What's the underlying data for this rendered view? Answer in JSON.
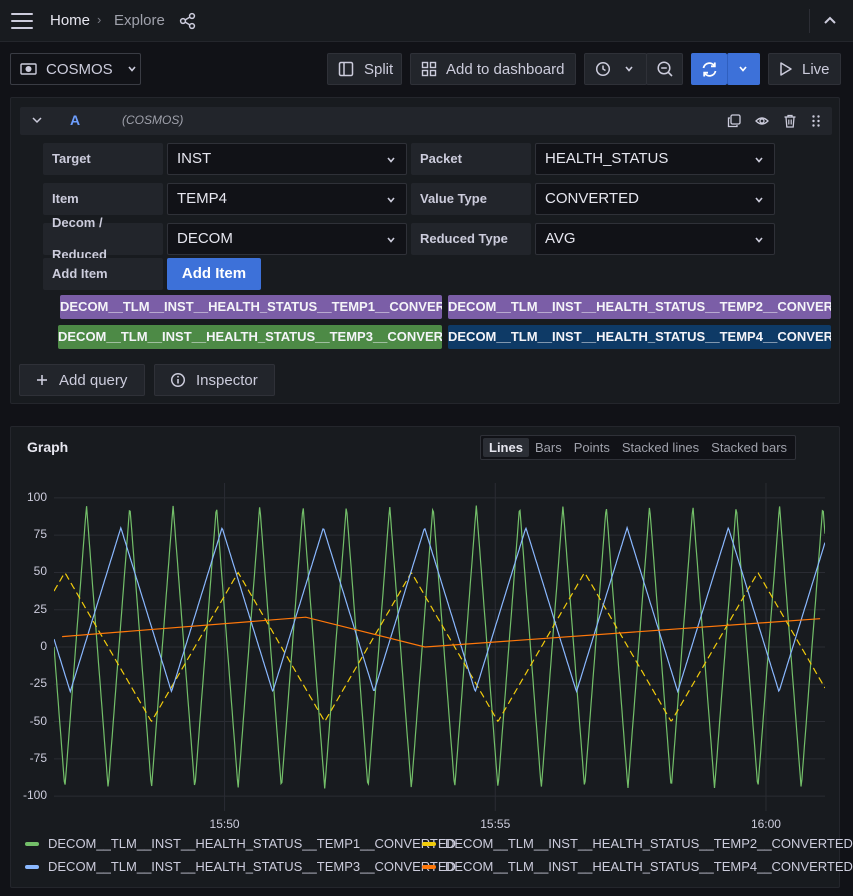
{
  "nav": {
    "home": "Home",
    "separator": "›",
    "explore": "Explore"
  },
  "toolbar": {
    "datasource": "COSMOS",
    "split": "Split",
    "add_to_dashboard": "Add to dashboard",
    "live": "Live"
  },
  "query": {
    "refid": "A",
    "datasource": "(COSMOS)",
    "fields": {
      "target_label": "Target",
      "target_value": "INST",
      "packet_label": "Packet",
      "packet_value": "HEALTH_STATUS",
      "item_label": "Item",
      "item_value": "TEMP4",
      "valuetype_label": "Value Type",
      "valuetype_value": "CONVERTED",
      "decom_label_1": "Decom /",
      "decom_label_2": "Reduced",
      "decom_value": "DECOM",
      "reducedtype_label": "Reduced Type",
      "reducedtype_value": "AVG",
      "additem_label": "Add Item",
      "additem_button": "Add Item"
    },
    "items": [
      {
        "label": "DECOM__TLM__INST__HEALTH_STATUS__TEMP1__CONVERTED",
        "color": "#7b5ea7"
      },
      {
        "label": "DECOM__TLM__INST__HEALTH_STATUS__TEMP2__CONVERTED",
        "color": "#7b5ea7"
      },
      {
        "label": "DECOM__TLM__INST__HEALTH_STATUS__TEMP3__CONVERTED",
        "color": "#4d8a46"
      },
      {
        "label": "DECOM__TLM__INST__HEALTH_STATUS__TEMP4__CONVERTED",
        "color": "#0e3a66"
      }
    ],
    "add_query": "Add query",
    "inspector": "Inspector"
  },
  "graph": {
    "title": "Graph",
    "modes": [
      "Lines",
      "Bars",
      "Points",
      "Stacked lines",
      "Stacked bars"
    ],
    "active_mode": "Lines"
  },
  "colors": {
    "accent_blue": "#3d71d9",
    "temp1": "#73bf69",
    "temp2": "#f2cc0c",
    "temp3": "#8ab8ff",
    "temp4": "#ff780a"
  },
  "chart_data": {
    "type": "line",
    "title": "Graph",
    "xlabel": "",
    "ylabel": "",
    "x_tick_labels": [
      "15:50",
      "15:55",
      "16:00"
    ],
    "y_tick_labels": [
      "100",
      "75",
      "50",
      "25",
      "0",
      "-25",
      "-50",
      "-75",
      "-100"
    ],
    "xlim": [
      "15:47",
      "16:01"
    ],
    "ylim": [
      -110,
      110
    ],
    "legend_position": "bottom",
    "grid": true,
    "series": [
      {
        "name": "DECOM__TLM__INST__HEALTH_STATUS__TEMP1__CONVERTED",
        "color": "#73bf69",
        "shape": "triangle",
        "amplitude": 95,
        "period_min": 0.8,
        "phase_min": 0.2,
        "min": -95,
        "max": 95
      },
      {
        "name": "DECOM__TLM__INST__HEALTH_STATUS__TEMP2__CONVERTED",
        "color": "#f2cc0c",
        "shape": "triangle",
        "dashed": true,
        "min": -50,
        "max": 50,
        "center": 0,
        "period_min": 3.2,
        "phase_min": 1.8
      },
      {
        "name": "DECOM__TLM__INST__HEALTH_STATUS__TEMP3__CONVERTED",
        "color": "#8ab8ff",
        "shape": "triangle",
        "min": -30,
        "max": 80,
        "period_min": 1.87,
        "phase_min": 0.3
      },
      {
        "name": "DECOM__TLM__INST__HEALTH_STATUS__TEMP4__CONVERTED",
        "color": "#ff780a",
        "shape": "piecewise",
        "points": [
          [
            "15:47",
            7
          ],
          [
            "15:51.5",
            20
          ],
          [
            "15:53.7",
            0
          ],
          [
            "16:01",
            19
          ]
        ]
      }
    ]
  }
}
